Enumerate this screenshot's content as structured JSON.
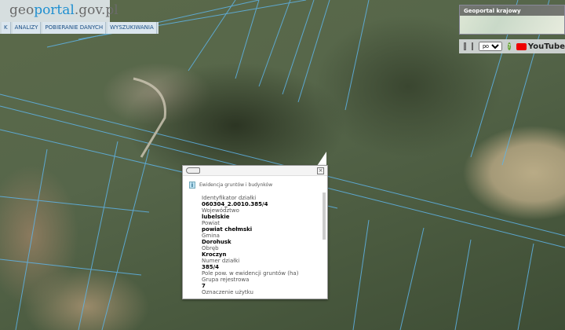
{
  "logo": {
    "part1": "geo",
    "part2": "portal",
    "part3": ".gov.pl"
  },
  "nav": {
    "items": [
      "K",
      "ANALIZY",
      "POBIERANIE DANYCH",
      "WYSZUKIWANIA"
    ]
  },
  "minimap": {
    "title": "Geoportal krajowy"
  },
  "toolbar": {
    "language": "pol",
    "youtube": "YouTube"
  },
  "popup": {
    "source": "Ewidencja gruntów i budynków",
    "fields": [
      {
        "label": "Identyfikator działki",
        "value": "060304_2.0010.385/4"
      },
      {
        "label": "Województwo",
        "value": "lubelskie"
      },
      {
        "label": "Powiat",
        "value": "powiat chełmski"
      },
      {
        "label": "Gmina",
        "value": "Dorohusk"
      },
      {
        "label": "Obręb",
        "value": "Kroczyn"
      },
      {
        "label": "Numer działki",
        "value": "385/4"
      },
      {
        "label": "Pole pow. w ewidencji gruntów (ha)",
        "value": ""
      },
      {
        "label": "Grupa rejestrowa",
        "value": "7"
      },
      {
        "label": "Oznaczenie użytku",
        "value": ""
      }
    ]
  }
}
